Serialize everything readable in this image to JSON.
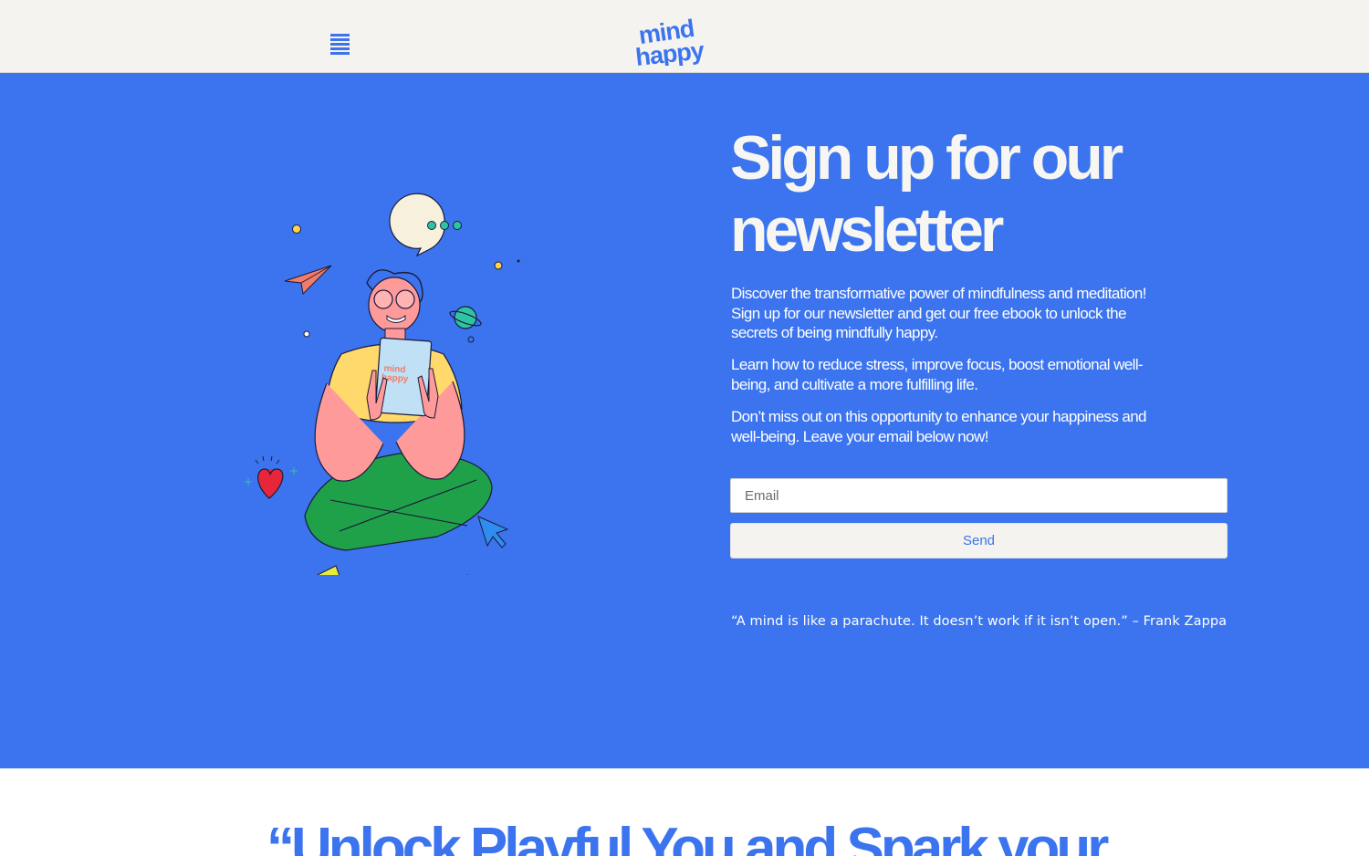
{
  "header": {
    "menu_icon": "hamburger-menu-icon",
    "logo_line1": "mind",
    "logo_line2": "happy"
  },
  "illustration": {
    "book_title_line1": "mind",
    "book_title_line2": "happy"
  },
  "newsletter": {
    "title": "Sign up for our newsletter",
    "paragraphs": [
      "Discover the transformative power of mindfulness and meditation! Sign up for our newsletter and get our free ebook to unlock the secrets of being mindfully happy.",
      "Learn how to reduce stress, improve focus, boost emotional well-being, and cultivate a more fulfilling life.",
      "Don’t miss out on this opportunity to enhance your happiness and well-being. Leave your email below now!"
    ],
    "email_placeholder": "Email",
    "send_label": "Send",
    "quote": "“A mind is like a parachute. It doesn’t work if it isn’t open.” – Frank Zappa"
  },
  "next_section": {
    "heading": "“Unlock Playful You and Spark your"
  },
  "colors": {
    "brand_blue": "#3b74ee",
    "header_bg": "#f4f3ef",
    "text_light": "#f7f6f2"
  }
}
